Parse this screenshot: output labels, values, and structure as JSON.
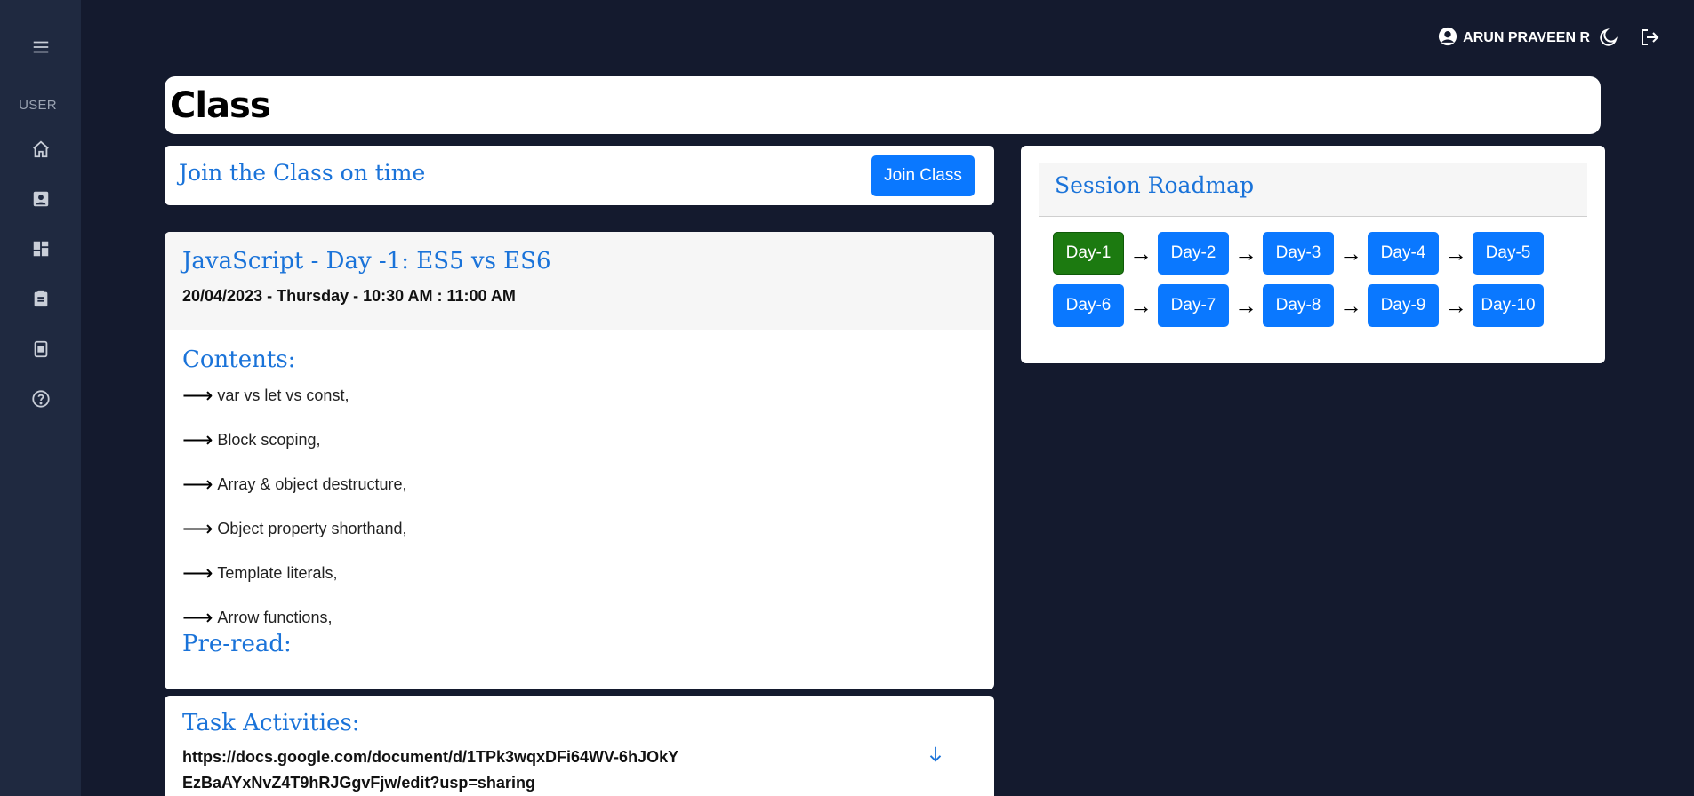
{
  "sidebar": {
    "section_label": "USER",
    "icons": [
      "menu-icon",
      "home-icon",
      "profile-icon",
      "dashboard-icon",
      "clipboard-icon",
      "calendar-icon",
      "help-icon"
    ]
  },
  "topbar": {
    "user_name": "ARUN PRAVEEN R"
  },
  "page": {
    "title": "Class"
  },
  "join": {
    "text": "Join the Class on time",
    "button_label": "Join Class"
  },
  "session": {
    "title": "JavaScript - Day -1: ES5 vs ES6",
    "datetime": "20/04/2023 - Thursday - 10:30 AM : 11:00 AM",
    "contents_heading": "Contents:",
    "contents": [
      "var vs let vs const,",
      "Block scoping,",
      "Array & object destructure,",
      "Object property shorthand,",
      "Template literals,",
      "Arrow functions,"
    ],
    "preread_heading": "Pre-read:"
  },
  "tasks": {
    "heading": "Task Activities:",
    "link": "https://docs.google.com/document/d/1TPk3wqxDFi64WV-6hJOkYEzBaAYxNvZ4T9hRJGgvFjw/edit?usp=sharing"
  },
  "roadmap": {
    "heading": "Session Roadmap",
    "active_day": "Day-1",
    "active_color": "#1c7a10",
    "day_color": "#0a78ff",
    "rows": [
      [
        "Day-1",
        "Day-2",
        "Day-3",
        "Day-4",
        "Day-5"
      ],
      [
        "Day-6",
        "Day-7",
        "Day-8",
        "Day-9",
        "Day-10"
      ]
    ]
  }
}
